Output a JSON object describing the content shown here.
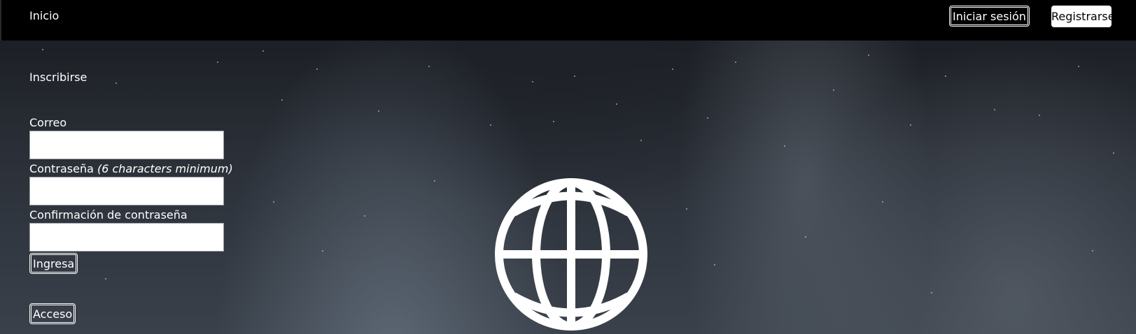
{
  "nav": {
    "home_label": "Inicio",
    "login_label": "Iniciar sesión",
    "register_label": "Registrarse"
  },
  "form": {
    "title": "Inscribirse",
    "email_label": "Correo",
    "email_value": "",
    "password_label": "Contraseña",
    "password_hint": "(6 characters minimum)",
    "password_value": "",
    "confirm_label": "Confirmación de contraseña",
    "confirm_value": "",
    "submit_label": "Ingresa"
  },
  "access_label": "Acceso",
  "icons": {
    "hero": "globe-icon"
  },
  "colors": {
    "topbar": "#000000",
    "text": "#ffffff",
    "register_bg": "#ffffff",
    "register_text": "#000000"
  }
}
